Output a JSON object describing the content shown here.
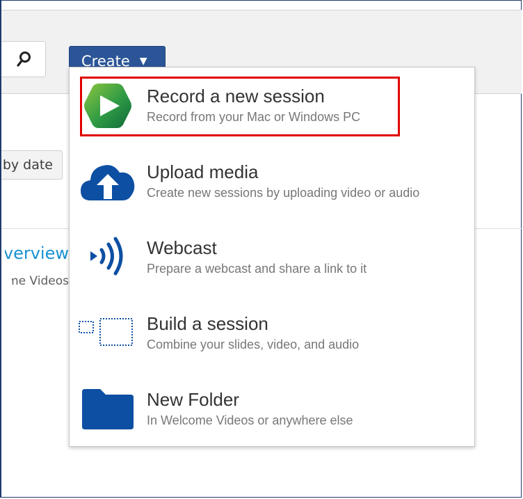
{
  "toolbar": {
    "create_label": "Create",
    "create_caret": "▼",
    "search_icon": "search-icon"
  },
  "sort": {
    "label": "by date"
  },
  "folder": {
    "title": "Overview",
    "subtitle": "Welcome Videos"
  },
  "create_menu": {
    "items": [
      {
        "title": "Record a new session",
        "description": "Record from your Mac or Windows PC",
        "icon": "panopto-record-icon"
      },
      {
        "title": "Upload media",
        "description": "Create new sessions by uploading video or audio",
        "icon": "cloud-upload-icon"
      },
      {
        "title": "Webcast",
        "description": "Prepare a webcast and share a link to it",
        "icon": "webcast-icon"
      },
      {
        "title": "Build a session",
        "description": "Combine your slides, video, and audio",
        "icon": "build-session-icon"
      },
      {
        "title": "New Folder",
        "description": "In Welcome Videos or anywhere else",
        "icon": "folder-icon"
      }
    ]
  },
  "colors": {
    "create_button": "#2b5597",
    "menu_icon_blue": "#0d4fa3",
    "highlight": "#e00000",
    "folder_link": "#1a91d1"
  }
}
